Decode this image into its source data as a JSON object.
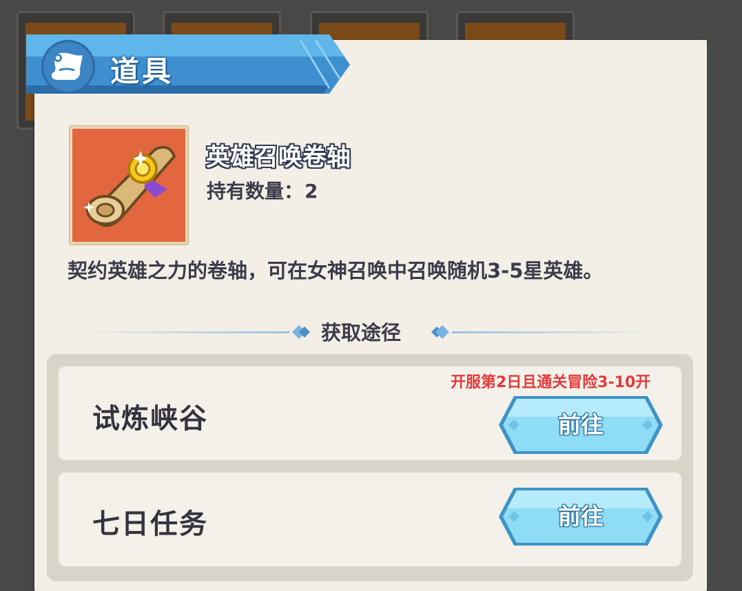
{
  "header": {
    "title": "道具",
    "icon": "scroll-icon"
  },
  "item": {
    "name": "英雄召唤卷轴",
    "count_label": "持有数量：",
    "count_value": "2",
    "icon": "hero-summon-scroll-icon",
    "description": "契约英雄之力的卷轴，可在女神召唤中召唤随机3-5星英雄。"
  },
  "section": {
    "title": "获取途径"
  },
  "sources": [
    {
      "name": "试炼峡谷",
      "condition": "开服第2日且通关冒险3-10开",
      "button": "前往"
    },
    {
      "name": "七日任务",
      "condition": "",
      "button": "前往"
    }
  ],
  "colors": {
    "accent_blue": "#4ea8dc",
    "button_cyan": "#8fdcf6",
    "condition_red": "#e4393a",
    "panel_bg": "#f3efe6"
  }
}
